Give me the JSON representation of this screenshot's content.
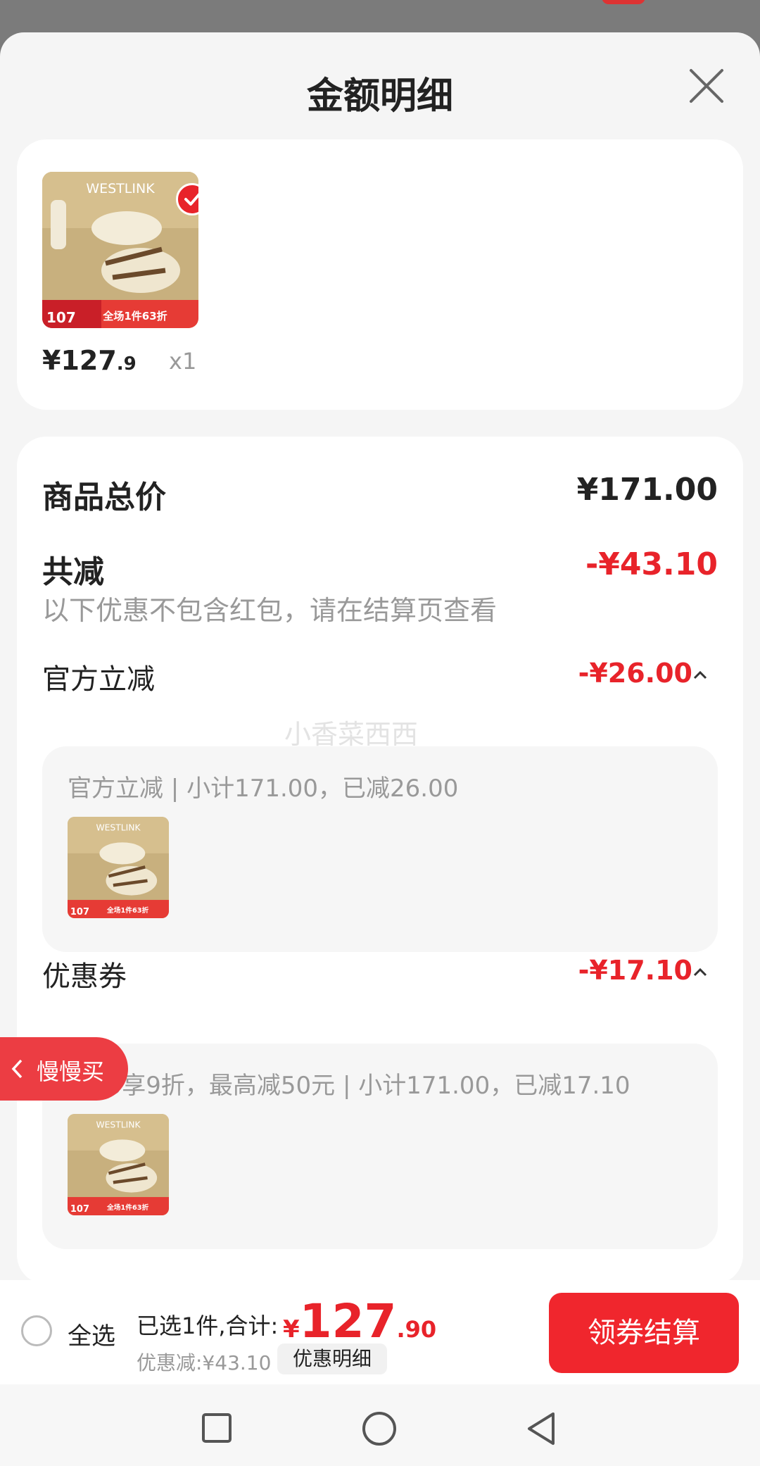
{
  "sheet": {
    "title": "金额明细",
    "close_icon": "close-icon"
  },
  "product": {
    "price_int": "¥127",
    "price_dec": ".9",
    "qty": "x1",
    "image_brand": "WESTLINK",
    "badge_price": "107",
    "promo": "全场1件63折"
  },
  "summary": {
    "total_label": "商品总价",
    "total_value": "¥171.00",
    "discount_label": "共减",
    "discount_value": "-¥43.10",
    "discount_note": "以下优惠不包含红包，请在结算页查看"
  },
  "official": {
    "label": "官方立减",
    "value": "-¥26.00",
    "detail": "官方立减 | 小计171.00，已减26.00"
  },
  "coupon": {
    "label": "优惠券",
    "value": "-¥17.10",
    "detail": "满50享9折，最高减50元 | 小计171.00，已减17.10"
  },
  "watermark": "小香菜西西",
  "float_tag": "慢慢买",
  "bottom": {
    "select_all": "全选",
    "selected": "已选1件,合计:",
    "total_cur": "¥",
    "total_int": "127",
    "total_dec": ".90",
    "discount": "优惠减:¥43.10",
    "detail_button": "优惠明细",
    "checkout_button": "领券结算"
  },
  "colors": {
    "accent": "#e8232a",
    "sheet_bg": "#f5f5f5"
  }
}
